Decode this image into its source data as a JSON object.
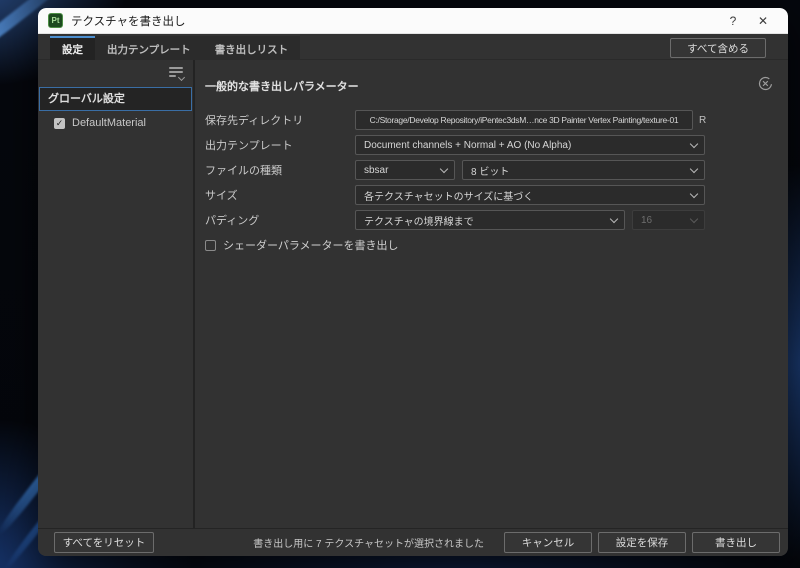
{
  "window": {
    "title": "テクスチャを書き出し",
    "app_icon_text": "Pt",
    "help_label": "?",
    "close_label": "✕"
  },
  "tabs": [
    {
      "label": "設定",
      "selected": true
    },
    {
      "label": "出力テンプレート",
      "selected": false
    },
    {
      "label": "書き出しリスト",
      "selected": false
    }
  ],
  "toolbar": {
    "include_all_label": "すべて含める"
  },
  "sidebar": {
    "items": [
      {
        "label": "グローバル設定",
        "selected": true
      },
      {
        "label": "DefaultMaterial",
        "checked": true
      }
    ]
  },
  "parameters": {
    "section_title": "一般的な書き出しパラメーター",
    "directory": {
      "label": "保存先ディレクトリ",
      "value": "C:/Storage/Develop Repository/iPentec3dsM…nce 3D Painter Vertex Painting/texture-01",
      "suffix": "R"
    },
    "template": {
      "label": "出力テンプレート",
      "value": "Document channels + Normal + AO (No Alpha)"
    },
    "file_type": {
      "label": "ファイルの種類",
      "value": "sbsar",
      "bit_depth": "8 ビット"
    },
    "size": {
      "label": "サイズ",
      "value": "各テクスチャセットのサイズに基づく"
    },
    "padding": {
      "label": "パディング",
      "value": "テクスチャの境界線まで",
      "dilation": "16"
    },
    "shader_params": {
      "label": "シェーダーパラメーターを書き出し",
      "checked": false
    }
  },
  "footer": {
    "reset_all_label": "すべてをリセット",
    "status": "書き出し用に 7 テクスチャセットが選択されました",
    "cancel_label": "キャンセル",
    "save_settings_label": "設定を保存",
    "export_label": "書き出し"
  },
  "icons": {
    "check": "✓"
  },
  "colors": {
    "accent_tab": "#4c8fd0",
    "selection_border": "#3a6ea5",
    "dialog_body": "#323232",
    "titlebar": "#fbfbfb",
    "field_bg": "#2b2b2b",
    "field_border": "#565656",
    "app_icon_green": "#1d4a1f"
  }
}
